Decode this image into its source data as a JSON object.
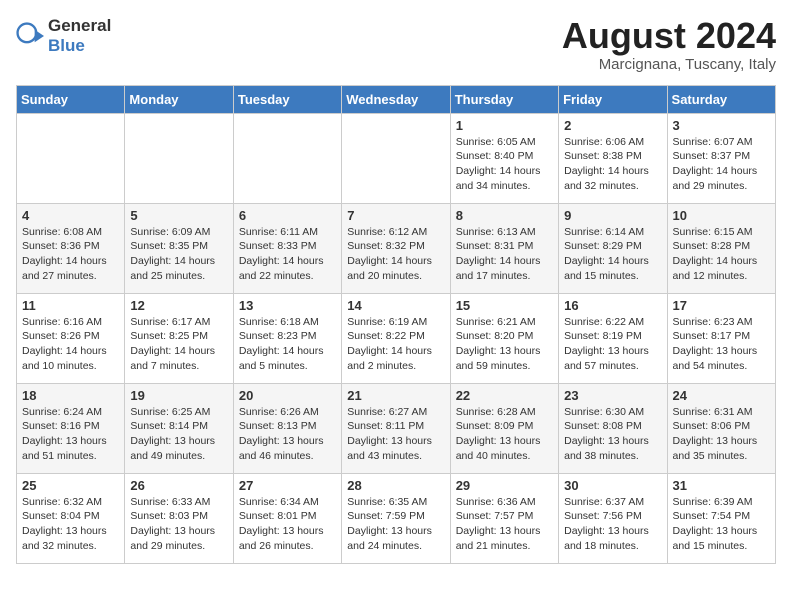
{
  "header": {
    "logo_general": "General",
    "logo_blue": "Blue",
    "title": "August 2024",
    "subtitle": "Marcignana, Tuscany, Italy"
  },
  "days_of_week": [
    "Sunday",
    "Monday",
    "Tuesday",
    "Wednesday",
    "Thursday",
    "Friday",
    "Saturday"
  ],
  "weeks": [
    [
      {
        "day": "",
        "info": ""
      },
      {
        "day": "",
        "info": ""
      },
      {
        "day": "",
        "info": ""
      },
      {
        "day": "",
        "info": ""
      },
      {
        "day": "1",
        "info": "Sunrise: 6:05 AM\nSunset: 8:40 PM\nDaylight: 14 hours and 34 minutes."
      },
      {
        "day": "2",
        "info": "Sunrise: 6:06 AM\nSunset: 8:38 PM\nDaylight: 14 hours and 32 minutes."
      },
      {
        "day": "3",
        "info": "Sunrise: 6:07 AM\nSunset: 8:37 PM\nDaylight: 14 hours and 29 minutes."
      }
    ],
    [
      {
        "day": "4",
        "info": "Sunrise: 6:08 AM\nSunset: 8:36 PM\nDaylight: 14 hours and 27 minutes."
      },
      {
        "day": "5",
        "info": "Sunrise: 6:09 AM\nSunset: 8:35 PM\nDaylight: 14 hours and 25 minutes."
      },
      {
        "day": "6",
        "info": "Sunrise: 6:11 AM\nSunset: 8:33 PM\nDaylight: 14 hours and 22 minutes."
      },
      {
        "day": "7",
        "info": "Sunrise: 6:12 AM\nSunset: 8:32 PM\nDaylight: 14 hours and 20 minutes."
      },
      {
        "day": "8",
        "info": "Sunrise: 6:13 AM\nSunset: 8:31 PM\nDaylight: 14 hours and 17 minutes."
      },
      {
        "day": "9",
        "info": "Sunrise: 6:14 AM\nSunset: 8:29 PM\nDaylight: 14 hours and 15 minutes."
      },
      {
        "day": "10",
        "info": "Sunrise: 6:15 AM\nSunset: 8:28 PM\nDaylight: 14 hours and 12 minutes."
      }
    ],
    [
      {
        "day": "11",
        "info": "Sunrise: 6:16 AM\nSunset: 8:26 PM\nDaylight: 14 hours and 10 minutes."
      },
      {
        "day": "12",
        "info": "Sunrise: 6:17 AM\nSunset: 8:25 PM\nDaylight: 14 hours and 7 minutes."
      },
      {
        "day": "13",
        "info": "Sunrise: 6:18 AM\nSunset: 8:23 PM\nDaylight: 14 hours and 5 minutes."
      },
      {
        "day": "14",
        "info": "Sunrise: 6:19 AM\nSunset: 8:22 PM\nDaylight: 14 hours and 2 minutes."
      },
      {
        "day": "15",
        "info": "Sunrise: 6:21 AM\nSunset: 8:20 PM\nDaylight: 13 hours and 59 minutes."
      },
      {
        "day": "16",
        "info": "Sunrise: 6:22 AM\nSunset: 8:19 PM\nDaylight: 13 hours and 57 minutes."
      },
      {
        "day": "17",
        "info": "Sunrise: 6:23 AM\nSunset: 8:17 PM\nDaylight: 13 hours and 54 minutes."
      }
    ],
    [
      {
        "day": "18",
        "info": "Sunrise: 6:24 AM\nSunset: 8:16 PM\nDaylight: 13 hours and 51 minutes."
      },
      {
        "day": "19",
        "info": "Sunrise: 6:25 AM\nSunset: 8:14 PM\nDaylight: 13 hours and 49 minutes."
      },
      {
        "day": "20",
        "info": "Sunrise: 6:26 AM\nSunset: 8:13 PM\nDaylight: 13 hours and 46 minutes."
      },
      {
        "day": "21",
        "info": "Sunrise: 6:27 AM\nSunset: 8:11 PM\nDaylight: 13 hours and 43 minutes."
      },
      {
        "day": "22",
        "info": "Sunrise: 6:28 AM\nSunset: 8:09 PM\nDaylight: 13 hours and 40 minutes."
      },
      {
        "day": "23",
        "info": "Sunrise: 6:30 AM\nSunset: 8:08 PM\nDaylight: 13 hours and 38 minutes."
      },
      {
        "day": "24",
        "info": "Sunrise: 6:31 AM\nSunset: 8:06 PM\nDaylight: 13 hours and 35 minutes."
      }
    ],
    [
      {
        "day": "25",
        "info": "Sunrise: 6:32 AM\nSunset: 8:04 PM\nDaylight: 13 hours and 32 minutes."
      },
      {
        "day": "26",
        "info": "Sunrise: 6:33 AM\nSunset: 8:03 PM\nDaylight: 13 hours and 29 minutes."
      },
      {
        "day": "27",
        "info": "Sunrise: 6:34 AM\nSunset: 8:01 PM\nDaylight: 13 hours and 26 minutes."
      },
      {
        "day": "28",
        "info": "Sunrise: 6:35 AM\nSunset: 7:59 PM\nDaylight: 13 hours and 24 minutes."
      },
      {
        "day": "29",
        "info": "Sunrise: 6:36 AM\nSunset: 7:57 PM\nDaylight: 13 hours and 21 minutes."
      },
      {
        "day": "30",
        "info": "Sunrise: 6:37 AM\nSunset: 7:56 PM\nDaylight: 13 hours and 18 minutes."
      },
      {
        "day": "31",
        "info": "Sunrise: 6:39 AM\nSunset: 7:54 PM\nDaylight: 13 hours and 15 minutes."
      }
    ]
  ]
}
